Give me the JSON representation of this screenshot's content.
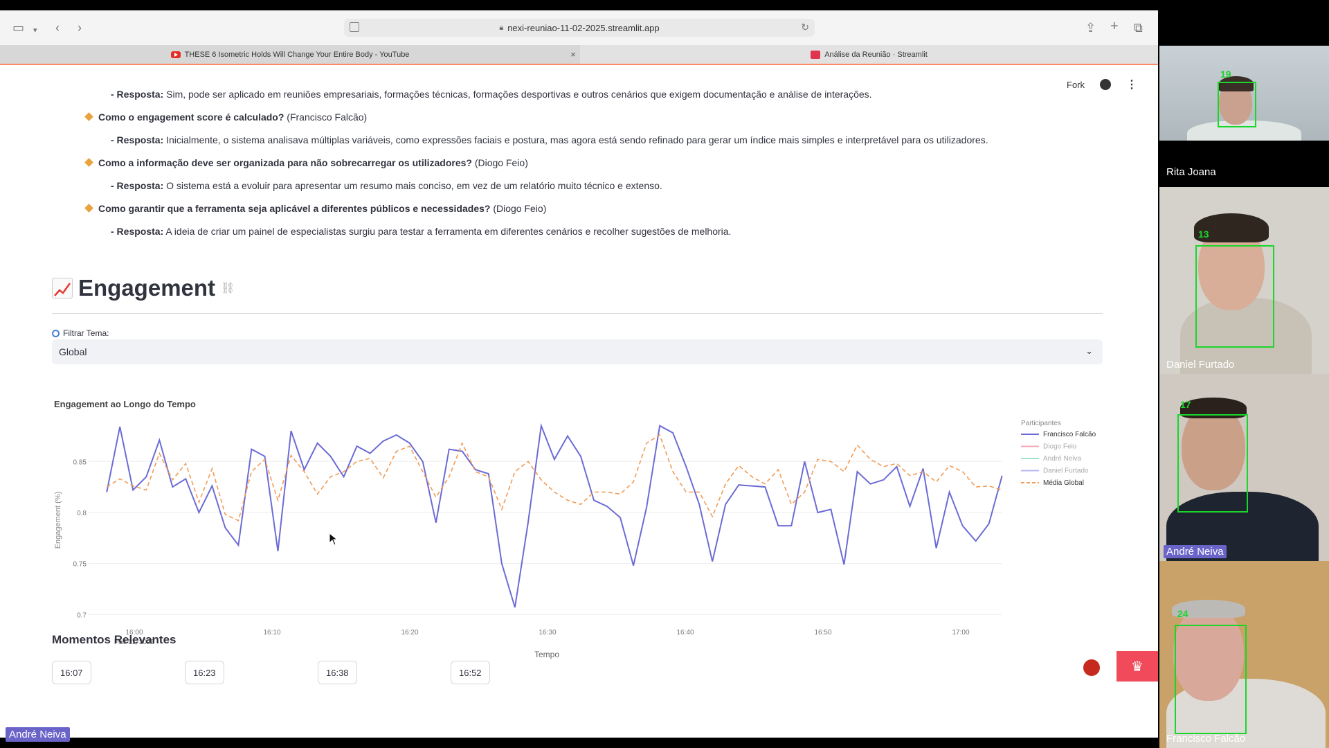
{
  "browser": {
    "url": "nexi-reuniao-11-02-2025.streamlit.app",
    "tabs": [
      {
        "title": "THESE 6 Isometric Holds Will Change Your Entire Body - YouTube",
        "active": false
      },
      {
        "title": "Análise da Reunião · Streamlit",
        "active": true
      }
    ],
    "close_symbol": "×"
  },
  "st_header": {
    "fork_label": "Fork"
  },
  "qa": {
    "items": [
      {
        "kind": "answer",
        "label": "- Resposta:",
        "text": " Sim, pode ser aplicado em reuniões empresariais, formações técnicas, formações desportivas e outros cenários que exigem documentação e análise de interações."
      },
      {
        "kind": "question",
        "label": "Como o engagement score é calculado?",
        "text": " (Francisco Falcão)"
      },
      {
        "kind": "answer",
        "label": "- Resposta:",
        "text": " Inicialmente, o sistema analisava múltiplas variáveis, como expressões faciais e postura, mas agora está sendo refinado para gerar um índice mais simples e interpretável para os utilizadores."
      },
      {
        "kind": "question",
        "label": "Como a informação deve ser organizada para não sobrecarregar os utilizadores?",
        "text": " (Diogo Feio)"
      },
      {
        "kind": "answer",
        "label": "- Resposta:",
        "text": " O sistema está a evoluir para apresentar um resumo mais conciso, em vez de um relatório muito técnico e extenso."
      },
      {
        "kind": "question",
        "label": "Como garantir que a ferramenta seja aplicável a diferentes públicos e necessidades?",
        "text": " (Diogo Feio)"
      },
      {
        "kind": "answer",
        "label": "- Resposta:",
        "text": " A ideia de criar um painel de especialistas surgiu para testar a ferramenta em diferentes cenários e recolher sugestões de melhoria."
      }
    ]
  },
  "engagement": {
    "title": "Engagement",
    "filter_label": "Filtrar Tema:",
    "filter_value": "Global"
  },
  "chart_data": {
    "type": "line",
    "title": "Engagement ao Longo do Tempo",
    "xlabel": "Tempo",
    "ylabel": "Engagement (%)",
    "ylim": [
      0.69,
      0.895
    ],
    "yticks": [
      0.7,
      0.75,
      0.8,
      0.85
    ],
    "xticks": [
      "16:00",
      "16:10",
      "16:20",
      "16:30",
      "16:40",
      "16:50",
      "17:00"
    ],
    "xtick_sublabel": "Feb 11, 2025",
    "xrange_minutes": [
      0,
      63
    ],
    "legend_title": "Participantes",
    "legend_position": "right",
    "grid": true,
    "series": [
      {
        "name": "Francisco Falcão",
        "color": "#6c6bd6",
        "dash": false,
        "x_minutes_after_1600": [
          -2,
          -1,
          0,
          1,
          2,
          3,
          4,
          5,
          6,
          7,
          8,
          9,
          10,
          11,
          12,
          13,
          14,
          15,
          16,
          17,
          18,
          19,
          20,
          21,
          22,
          23,
          24,
          25,
          26,
          27,
          28,
          29,
          30,
          31,
          32,
          33,
          34,
          35,
          36,
          37,
          38,
          39,
          40,
          41,
          42,
          43,
          44,
          45,
          46,
          47,
          48,
          49,
          50,
          51,
          52,
          53,
          54,
          55,
          56,
          57,
          58,
          59,
          60,
          61,
          62,
          63
        ],
        "values": [
          0.82,
          0.884,
          0.822,
          0.835,
          0.871,
          0.825,
          0.833,
          0.8,
          0.826,
          0.785,
          0.768,
          0.862,
          0.855,
          0.762,
          0.88,
          0.842,
          0.868,
          0.855,
          0.835,
          0.865,
          0.858,
          0.87,
          0.876,
          0.868,
          0.85,
          0.79,
          0.862,
          0.86,
          0.842,
          0.838,
          0.75,
          0.707,
          0.79,
          0.885,
          0.852,
          0.875,
          0.855,
          0.812,
          0.806,
          0.795,
          0.748,
          0.805,
          0.885,
          0.878,
          0.845,
          0.808,
          0.752,
          0.808,
          0.827,
          0.826,
          0.825,
          0.787,
          0.787,
          0.85,
          0.8,
          0.803,
          0.749,
          0.84,
          0.828,
          0.832,
          0.845,
          0.806,
          0.843,
          0.765,
          0.82,
          0.787,
          0.772,
          0.789,
          0.836
        ]
      },
      {
        "name": "Diogo Feio",
        "color": "#f2a8b4",
        "dash": false,
        "values": []
      },
      {
        "name": "André Neiva",
        "color": "#9ee3c8",
        "dash": false,
        "values": []
      },
      {
        "name": "Daniel Furtado",
        "color": "#b8b4ee",
        "dash": false,
        "values": []
      },
      {
        "name": "Média Global",
        "color": "#f29b55",
        "dash": true,
        "x_minutes_after_1600": [
          -2,
          -1,
          0,
          1,
          2,
          3,
          4,
          5,
          6,
          7,
          8,
          9,
          10,
          11,
          12,
          13,
          14,
          15,
          16,
          17,
          18,
          19,
          20,
          21,
          22,
          23,
          24,
          25,
          26,
          27,
          28,
          29,
          30,
          31,
          32,
          33,
          34,
          35,
          36,
          37,
          38,
          39,
          40,
          41,
          42,
          43,
          44,
          45,
          46,
          47,
          48,
          49,
          50,
          51,
          52,
          53,
          54,
          55,
          56,
          57,
          58,
          59,
          60,
          61,
          62,
          63
        ],
        "values": [
          0.825,
          0.833,
          0.826,
          0.822,
          0.858,
          0.832,
          0.848,
          0.81,
          0.843,
          0.798,
          0.792,
          0.84,
          0.852,
          0.812,
          0.856,
          0.84,
          0.818,
          0.835,
          0.84,
          0.85,
          0.853,
          0.834,
          0.86,
          0.865,
          0.84,
          0.815,
          0.835,
          0.868,
          0.84,
          0.835,
          0.803,
          0.84,
          0.85,
          0.832,
          0.82,
          0.812,
          0.808,
          0.82,
          0.82,
          0.818,
          0.83,
          0.868,
          0.876,
          0.84,
          0.82,
          0.82,
          0.796,
          0.828,
          0.846,
          0.835,
          0.828,
          0.842,
          0.808,
          0.82,
          0.852,
          0.85,
          0.84,
          0.866,
          0.852,
          0.845,
          0.848,
          0.836,
          0.84,
          0.83,
          0.846,
          0.84,
          0.825,
          0.826,
          0.822
        ]
      }
    ]
  },
  "moments": {
    "title": "Momentos Relevantes",
    "times": [
      "16:07",
      "16:23",
      "16:38",
      "16:52"
    ]
  },
  "participants": [
    {
      "name": "Rita Joana",
      "face_id": "19",
      "highlighted": false
    },
    {
      "name": "Daniel Furtado",
      "face_id": "13",
      "highlighted": false
    },
    {
      "name": "André Neiva",
      "face_id": "17",
      "highlighted": true
    },
    {
      "name": "Francisco Falcão",
      "face_id": "24",
      "highlighted": false
    }
  ],
  "self_view": {
    "name": "André Neiva"
  }
}
